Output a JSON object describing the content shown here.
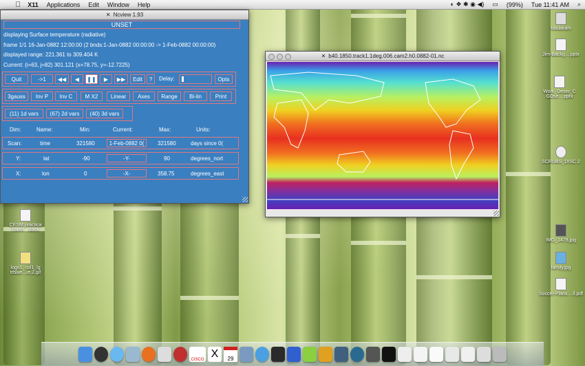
{
  "menubar": {
    "apple": "",
    "app": "X11",
    "menus": [
      "Applications",
      "Edit",
      "Window",
      "Help"
    ],
    "battery": "(99%)",
    "clock": "Tue 11:41 AM"
  },
  "ncview": {
    "title": "Ncview 1.93",
    "status": "UNSET",
    "line1": "displaying Surface temperature (radiative)",
    "line2": "frame 1/1 16-Jan-0882 12:00:00 (2 bnds:1-Jan-0882 00:00:00 -> 1-Feb-0882 00:00:00)",
    "line3": "displayed range: 221.361 to 309.404 K",
    "line4": "Current: (i=63, j=82) 301.121 (x=78.75, y=-12.7225)",
    "buttons": {
      "quit": "Quit",
      "step": "->1",
      "rewind": "◀◀",
      "back": "◀",
      "pause": "❚❚",
      "forward": "▶",
      "ffwd": "▶▶",
      "edit": "Edit",
      "help": "?",
      "delay": "Delay:",
      "opts": "Opts"
    },
    "row2": [
      "3gauss",
      "Inv P",
      "Inv C",
      "M X2",
      "Linear",
      "Axes",
      "Range",
      "Bi-lin",
      "Print"
    ],
    "vars": [
      "(11) 1d vars",
      "(67) 2d vars",
      "(40) 3d vars"
    ],
    "table": {
      "headers": [
        "Dim:",
        "Name:",
        "Min:",
        "Current:",
        "Max:",
        "Units:"
      ],
      "rows": [
        {
          "dim": "Scan:",
          "name": "time",
          "min": "321580",
          "current": "1-Feb-0882 0(",
          "max": "321580",
          "units": "days since 0("
        },
        {
          "dim": "Y:",
          "name": "lat",
          "min": "-90",
          "current": "-Y-",
          "max": "90",
          "units": "degrees_nort"
        },
        {
          "dim": "X:",
          "name": "lon",
          "min": "0",
          "current": "-X-",
          "max": "358.75",
          "units": "degrees_east"
        }
      ]
    }
  },
  "mapwin": {
    "title": "b40.1850.track1.1deg.006.cam2.h0.0882-01.nc"
  },
  "desktop": [
    {
      "label": "kaulakahi"
    },
    {
      "label": "Jim-Backg....pptx"
    },
    {
      "label": "Work_Deser_C GDse....pptx"
    },
    {
      "label": "SCRUBS_DISC 2"
    },
    {
      "label": "IMG_1478.jpg"
    },
    {
      "label": "family.jpg"
    },
    {
      "label": "Soccer-Plans....ll.pdf"
    },
    {
      "label": "CESM.practica l.outli....docx"
    },
    {
      "label": "logo1_col1_lg trblue....e.2.gif"
    }
  ],
  "dock": {
    "calendar_day": "29",
    "cisco": "CISCO"
  }
}
